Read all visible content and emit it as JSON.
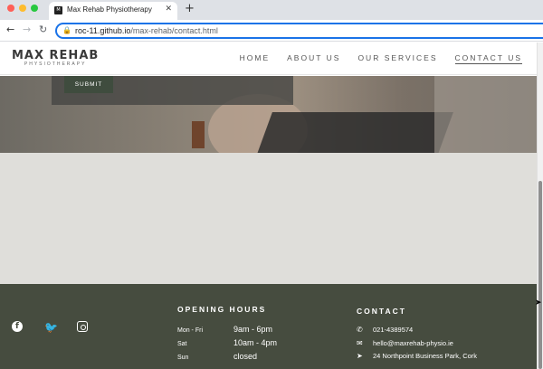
{
  "browser": {
    "tab_title": "Max Rehab Physiotherapy",
    "tab_favicon": "M",
    "url_host": "roc-11.github.io",
    "url_path": "/max-rehab/contact.html"
  },
  "site": {
    "logo_main": "MAX REHAB",
    "logo_sub": "PHYSIOTHERAPY",
    "nav": [
      "HOME",
      "ABOUT US",
      "OUR SERVICES",
      "CONTACT US"
    ],
    "active_nav": "CONTACT US",
    "submit_label": "SUBMIT"
  },
  "footer": {
    "opening_hours_title": "OPENING HOURS",
    "hours": [
      {
        "day": "Mon - Fri",
        "time": "9am - 6pm"
      },
      {
        "day": "Sat",
        "time": "10am - 4pm"
      },
      {
        "day": "Sun",
        "time": "closed"
      }
    ],
    "contact_title": "CONTACT",
    "contact": {
      "phone": "021-4389574",
      "email": "hello@maxrehab-physio.ie",
      "address": "24 Northpoint Business Park, Cork"
    },
    "social_icons": [
      "facebook-icon",
      "twitter-icon",
      "instagram-icon"
    ]
  },
  "colors": {
    "footer_bg": "#464c3f",
    "button_bg": "#3f4c3e",
    "omnibox_focus": "#1a73e8"
  }
}
